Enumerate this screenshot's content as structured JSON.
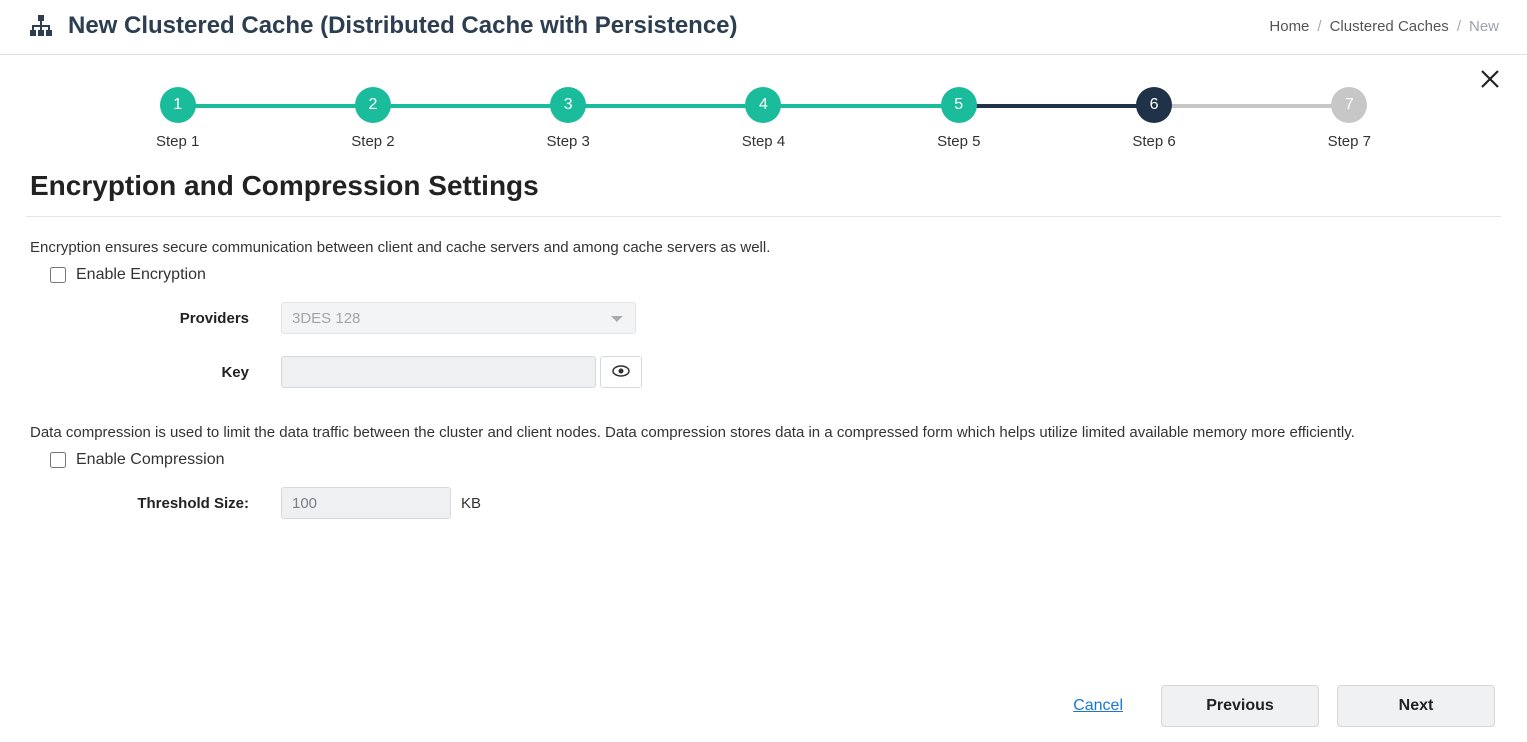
{
  "header": {
    "title": "New Clustered Cache (Distributed Cache with Persistence)"
  },
  "breadcrumb": {
    "home": "Home",
    "caches": "Clustered Caches",
    "current": "New"
  },
  "stepper": {
    "steps": [
      {
        "num": "1",
        "label": "Step 1",
        "state": "done"
      },
      {
        "num": "2",
        "label": "Step 2",
        "state": "done"
      },
      {
        "num": "3",
        "label": "Step 3",
        "state": "done"
      },
      {
        "num": "4",
        "label": "Step 4",
        "state": "done"
      },
      {
        "num": "5",
        "label": "Step 5",
        "state": "done"
      },
      {
        "num": "6",
        "label": "Step 6",
        "state": "active"
      },
      {
        "num": "7",
        "label": "Step 7",
        "state": "pending"
      }
    ],
    "connectors": [
      "done",
      "done",
      "done",
      "done",
      "done",
      "active",
      "pending"
    ]
  },
  "section": {
    "title": "Encryption and Compression Settings",
    "encryption_desc": "Encryption ensures secure communication between client and cache servers and among cache servers as well.",
    "enable_encryption_label": "Enable Encryption",
    "providers_label": "Providers",
    "providers_value": "3DES 128",
    "key_label": "Key",
    "key_value": "",
    "compression_desc": "Data compression is used to limit the data traffic between the cluster and client nodes. Data compression stores data in a compressed form which helps utilize limited available memory more efficiently.",
    "enable_compression_label": "Enable Compression",
    "threshold_label": "Threshold Size:",
    "threshold_value": "100",
    "threshold_unit": "KB"
  },
  "footer": {
    "cancel": "Cancel",
    "previous": "Previous",
    "next": "Next"
  }
}
